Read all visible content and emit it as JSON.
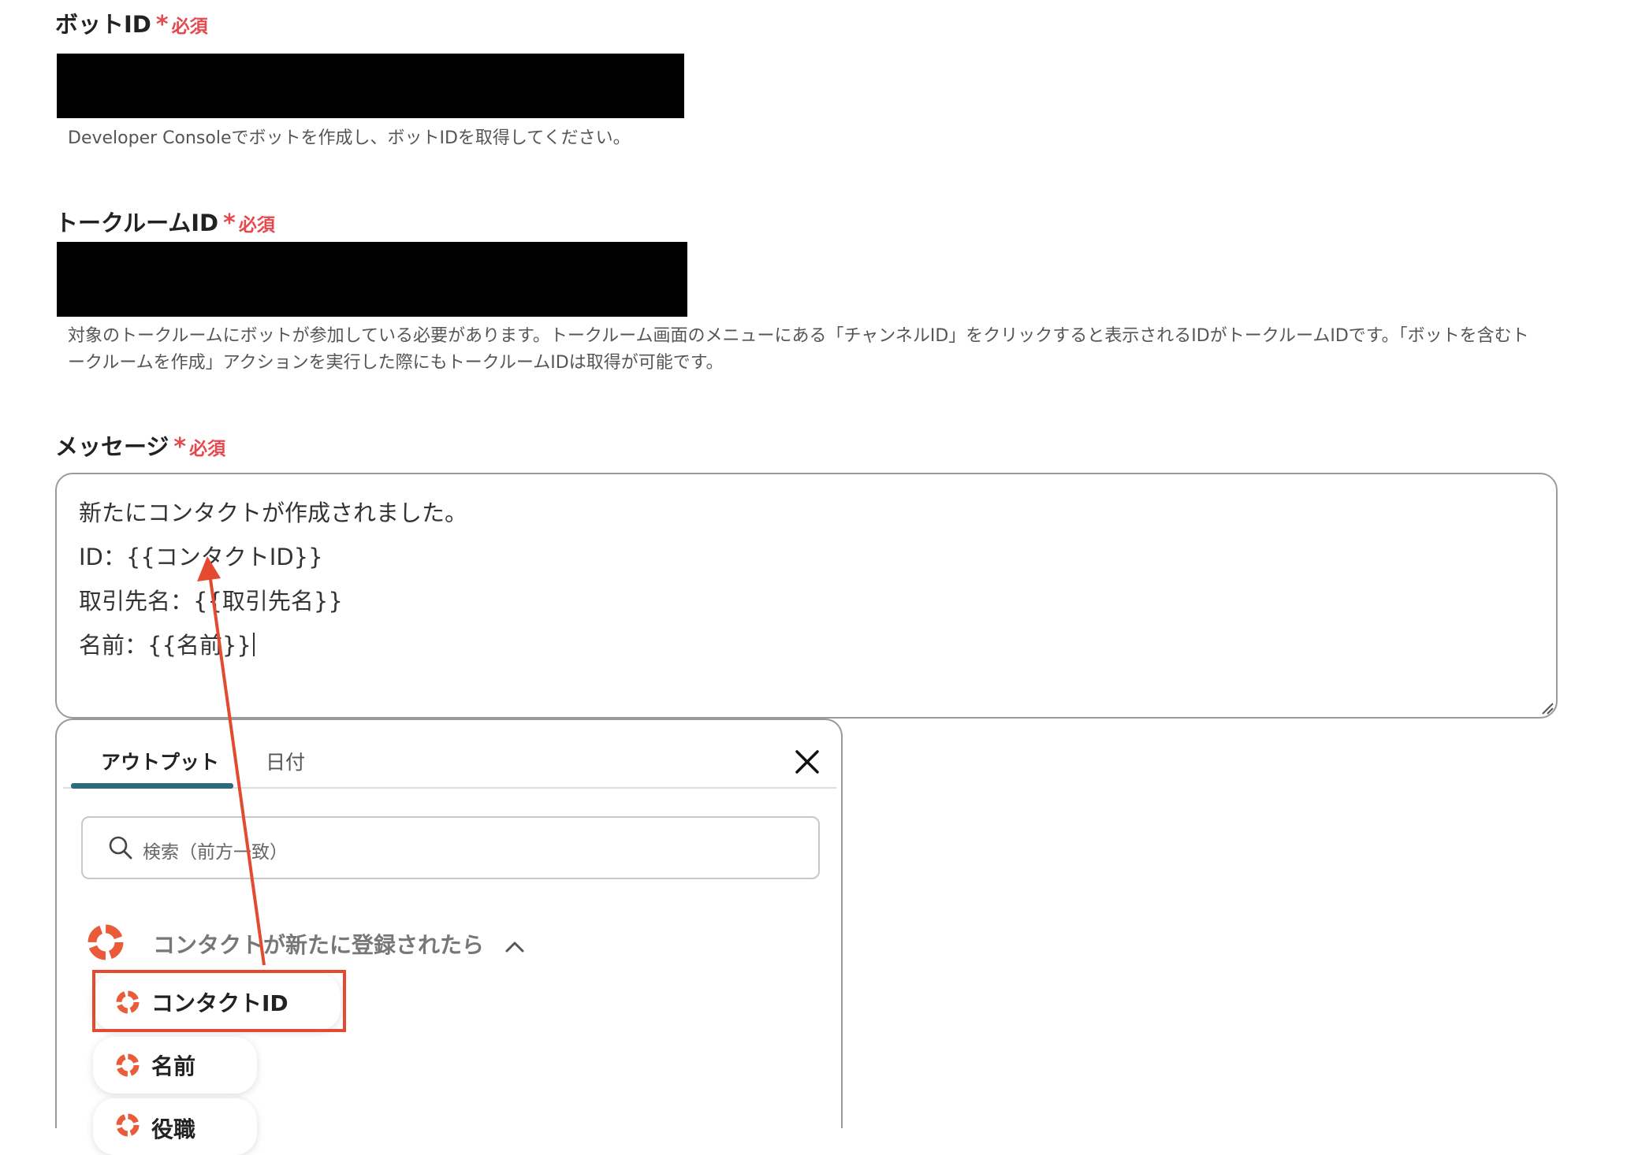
{
  "bot_id": {
    "label": "ボットID",
    "required_star": "*",
    "required_text": "必須",
    "helper": "Developer Consoleでボットを作成し、ボットIDを取得してください。"
  },
  "talkroom_id": {
    "label": "トークルームID",
    "required_star": "*",
    "required_text": "必須",
    "helper_line1": "対象のトークルームにボットが参加している必要があります。トークルーム画面のメニューにある「チャンネルID」をクリックすると表示されるIDがトークルームIDです。「ボットを含むト",
    "helper_line2": "ークルームを作成」アクションを実行した際にもトークルームIDは取得が可能です。"
  },
  "message": {
    "label": "メッセージ",
    "required_star": "*",
    "required_text": "必須",
    "lines": [
      "新たにコンタクトが作成されました。",
      "ID：{{コンタクトID}}",
      "取引先名：{{取引先名}}",
      "名前：{{名前}}"
    ]
  },
  "output_panel": {
    "tabs": [
      {
        "label": "アウトプット",
        "active": true
      },
      {
        "label": "日付",
        "active": false
      }
    ],
    "search_placeholder": "検索（前方一致）",
    "group_title": "コンタクトが新たに登録されたら",
    "items": [
      "コンタクトID",
      "名前",
      "役職"
    ]
  },
  "colors": {
    "required": "#e5484d",
    "annotation": "#e34a2f",
    "tab_underline": "#2d6a7e",
    "redaction": "#000000"
  },
  "icons": [
    "close-icon",
    "search-icon",
    "lifebuoy-icon",
    "chevron-up-icon",
    "resize-grip-icon"
  ]
}
